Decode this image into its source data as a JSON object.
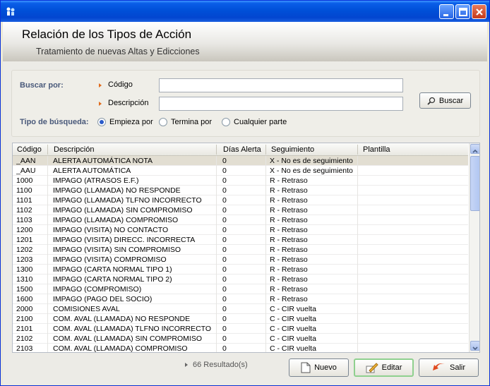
{
  "window": {
    "title": ""
  },
  "banner": {
    "title": "Relación de los Tipos de Acción",
    "subtitle": "Tratamiento de nuevas Altas y Edicciones"
  },
  "search": {
    "buscar_por": "Buscar por:",
    "codigo_label": "Código",
    "codigo_value": "",
    "descripcion_label": "Descripción",
    "descripcion_value": "",
    "buscar_button": "Buscar",
    "tipo_label": "Tipo de búsqueda:",
    "options": [
      "Empieza por",
      "Termina por",
      "Cualquier parte"
    ],
    "selected_option": "Empieza por"
  },
  "grid": {
    "columns": [
      "Código",
      "Descripción",
      "Días Alerta",
      "Seguimiento",
      "Plantilla"
    ],
    "rows": [
      [
        "_AAN",
        "ALERTA AUTOMÁTICA NOTA",
        "0",
        "X - No es de seguimiento",
        ""
      ],
      [
        "_AAU",
        "ALERTA AUTOMÁTICA",
        "0",
        "X - No es de seguimiento",
        ""
      ],
      [
        "1000",
        "IMPAGO (ATRASOS E.F.)",
        "0",
        "R - Retraso",
        ""
      ],
      [
        "1100",
        "IMPAGO (LLAMADA) NO RESPONDE",
        "0",
        "R - Retraso",
        ""
      ],
      [
        "1101",
        "IMPAGO (LLAMADA) TLFNO INCORRECTO",
        "0",
        "R - Retraso",
        ""
      ],
      [
        "1102",
        "IMPAGO (LLAMADA) SIN COMPROMISO",
        "0",
        "R - Retraso",
        ""
      ],
      [
        "1103",
        "IMPAGO (LLAMADA) COMPROMISO",
        "0",
        "R - Retraso",
        ""
      ],
      [
        "1200",
        "IMPAGO (VISITA) NO CONTACTO",
        "0",
        "R - Retraso",
        ""
      ],
      [
        "1201",
        "IMPAGO (VISITA) DIRECC. INCORRECTA",
        "0",
        "R - Retraso",
        ""
      ],
      [
        "1202",
        "IMPAGO (VISITA) SIN COMPROMISO",
        "0",
        "R - Retraso",
        ""
      ],
      [
        "1203",
        "IMPAGO (VISITA) COMPROMISO",
        "0",
        "R - Retraso",
        ""
      ],
      [
        "1300",
        "IMPAGO (CARTA NORMAL TIPO 1)",
        "0",
        "R - Retraso",
        ""
      ],
      [
        "1310",
        "IMPAGO (CARTA NORMAL TIPO 2)",
        "0",
        "R - Retraso",
        ""
      ],
      [
        "1500",
        "IMPAGO (COMPROMISO)",
        "0",
        "R - Retraso",
        ""
      ],
      [
        "1600",
        "IMPAGO (PAGO DEL SOCIO)",
        "0",
        "R - Retraso",
        ""
      ],
      [
        "2000",
        "COMISIONES AVAL",
        "0",
        "C - CIR vuelta",
        ""
      ],
      [
        "2100",
        "COM. AVAL (LLAMADA) NO RESPONDE",
        "0",
        "C - CIR vuelta",
        ""
      ],
      [
        "2101",
        "COM. AVAL (LLAMADA) TLFNO INCORRECTO",
        "0",
        "C - CIR vuelta",
        ""
      ],
      [
        "2102",
        "COM. AVAL (LLAMADA) SIN COMPROMISO",
        "0",
        "C - CIR vuelta",
        ""
      ],
      [
        "2103",
        "COM. AVAL (LLAMADA) COMPROMISO",
        "0",
        "C - CIR vuelta",
        ""
      ]
    ],
    "selected_row": 0
  },
  "footer": {
    "result_count": "66 Resultado(s)",
    "nuevo": "Nuevo",
    "editar": "Editar",
    "salir": "Salir"
  },
  "colors": {
    "titlebar": "#0054e3",
    "accent_arrow": "#e06a1b",
    "label_blue": "#49597a"
  }
}
